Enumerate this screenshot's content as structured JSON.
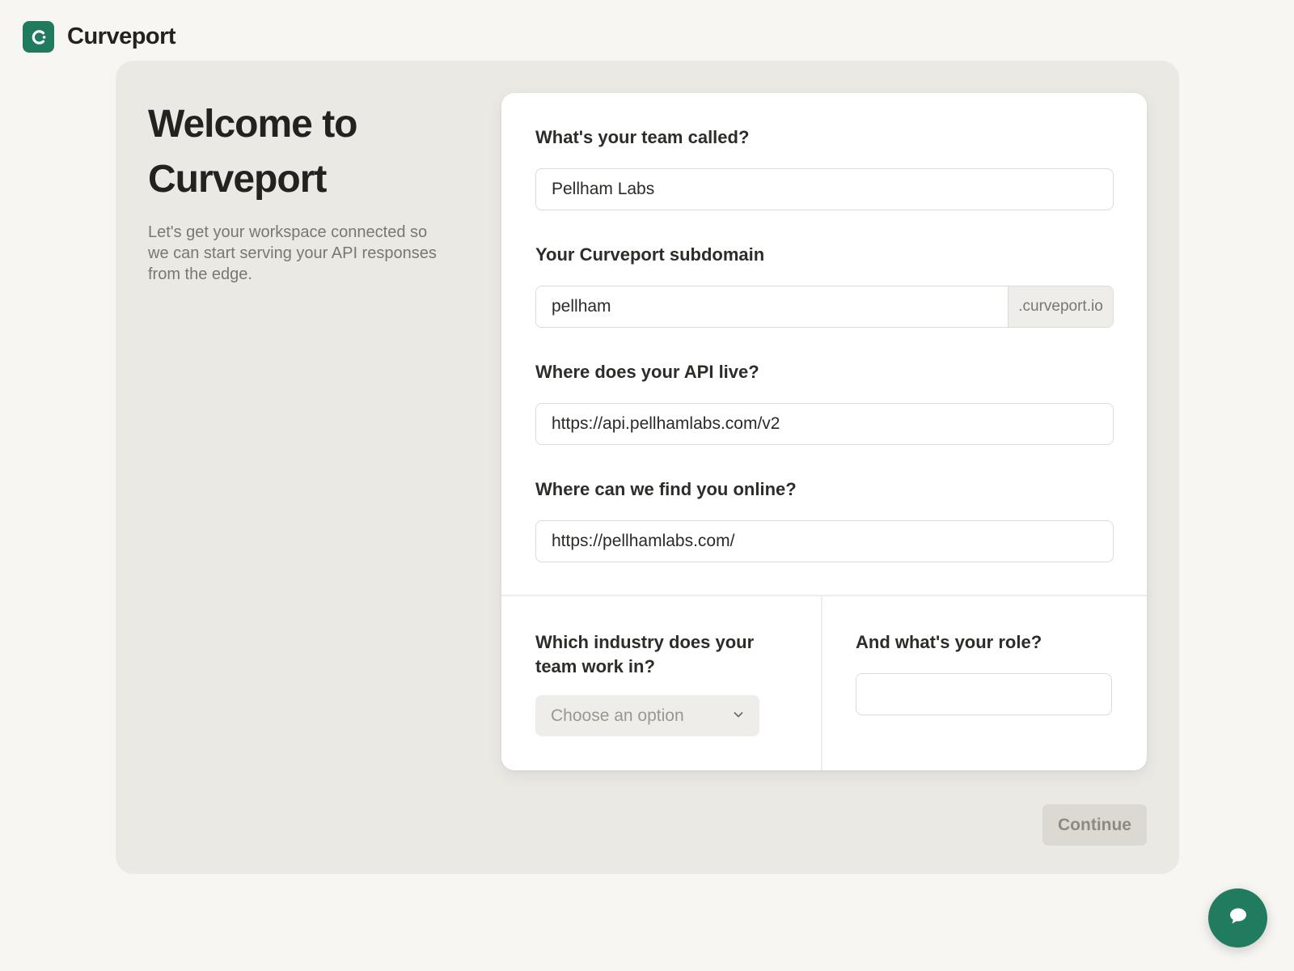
{
  "brand": {
    "name": "Curveport",
    "accent": "#1f7a5e"
  },
  "intro": {
    "title_line1": "Welcome to",
    "title_line2": "Curveport",
    "description": "Let's get your workspace connected so we can start serving your API responses from the edge."
  },
  "form": {
    "team_label": "What's your team called?",
    "team_value": "Pellham Labs",
    "subdomain_label": "Your Curveport subdomain",
    "subdomain_value": "pellham",
    "subdomain_suffix": ".curveport.io",
    "api_label": "Where does your API live?",
    "api_value": "https://api.pellhamlabs.com/v2",
    "website_label": "Where can we find you online?",
    "website_value": "https://pellhamlabs.com/",
    "industry_label": "Which industry does your team work in?",
    "industry_placeholder": "Choose an option",
    "role_label": "And what's your role?",
    "role_value": ""
  },
  "actions": {
    "continue_label": "Continue"
  },
  "icons": {
    "logo": "curveport-logo-icon",
    "select_arrow": "chevron-down-icon",
    "chat": "chat-bubble-icon"
  }
}
